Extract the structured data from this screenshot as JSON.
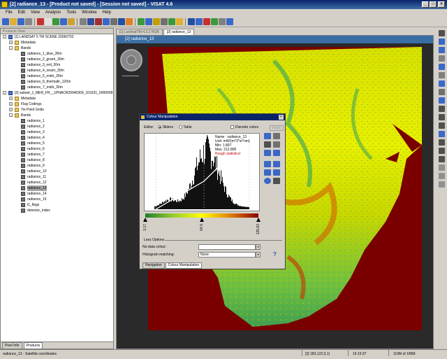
{
  "window": {
    "title": "[2] radiance_13 - [Product not saved] - [Session not saved] - VISAT 4.6",
    "minimize": "_",
    "maximize": "□",
    "close": "×"
  },
  "menu": [
    "File",
    "Edit",
    "View",
    "Analysis",
    "Tools",
    "Window",
    "Help"
  ],
  "toolbar_colors": [
    "#3a68c8",
    "#e0b030",
    "#3a68c8",
    "#888888",
    "#c83030",
    "#e0e0e0",
    "#3a9a3a",
    "#3a68c8",
    "#d0a030",
    "#808080",
    "#3050a0",
    "#a03030",
    "#3a68c8",
    "#707070",
    "#2050a0",
    "#e08020",
    "#3a9a3a",
    "#3a68c8",
    "#c0a000",
    "#707070",
    "#3a9a3a",
    "#e0b030",
    "#2050a0",
    "#3a68c8",
    "#c83030",
    "#3a9a3a",
    "#808080",
    "#3a68c8"
  ],
  "left_panel": {
    "header": "Products View",
    "tree": [
      {
        "indent": 0,
        "exp": "-",
        "icon": "prod",
        "label": "[1] LANDSAT 5 TM SCENE 20060702"
      },
      {
        "indent": 1,
        "exp": "+",
        "icon": "folder",
        "label": "Metadata"
      },
      {
        "indent": 1,
        "exp": "-",
        "icon": "folder",
        "label": "Bands"
      },
      {
        "indent": 2,
        "exp": "",
        "icon": "band",
        "label": "radiance_1_blue_30m"
      },
      {
        "indent": 2,
        "exp": "",
        "icon": "band",
        "label": "radiance_2_green_30m"
      },
      {
        "indent": 2,
        "exp": "",
        "icon": "band",
        "label": "radiance_3_red_30m"
      },
      {
        "indent": 2,
        "exp": "",
        "icon": "band",
        "label": "radiance_4_nearir_30m"
      },
      {
        "indent": 2,
        "exp": "",
        "icon": "band",
        "label": "radiance_5_midir_30m"
      },
      {
        "indent": 2,
        "exp": "",
        "icon": "band",
        "label": "radiance_6_thermalir_120m"
      },
      {
        "indent": 2,
        "exp": "",
        "icon": "band",
        "label": "radiance_7_midir_30m"
      },
      {
        "indent": 0,
        "exp": "-",
        "icon": "prod",
        "label": "[2] subset_1_MER_FR__1PNACR20040309_101631_0000009"
      },
      {
        "indent": 1,
        "exp": "+",
        "icon": "folder",
        "label": "Metadata"
      },
      {
        "indent": 1,
        "exp": "+",
        "icon": "folder",
        "label": "Flag Codings"
      },
      {
        "indent": 1,
        "exp": "+",
        "icon": "folder",
        "label": "Tie Point Grids"
      },
      {
        "indent": 1,
        "exp": "-",
        "icon": "folder",
        "label": "Bands"
      },
      {
        "indent": 2,
        "exp": "",
        "icon": "band",
        "label": "radiance_1"
      },
      {
        "indent": 2,
        "exp": "",
        "icon": "band",
        "label": "radiance_2"
      },
      {
        "indent": 2,
        "exp": "",
        "icon": "band",
        "label": "radiance_3"
      },
      {
        "indent": 2,
        "exp": "",
        "icon": "band",
        "label": "radiance_4"
      },
      {
        "indent": 2,
        "exp": "",
        "icon": "band",
        "label": "radiance_5"
      },
      {
        "indent": 2,
        "exp": "",
        "icon": "band",
        "label": "radiance_6"
      },
      {
        "indent": 2,
        "exp": "",
        "icon": "band",
        "label": "radiance_7"
      },
      {
        "indent": 2,
        "exp": "",
        "icon": "band",
        "label": "radiance_8"
      },
      {
        "indent": 2,
        "exp": "",
        "icon": "band",
        "label": "radiance_9"
      },
      {
        "indent": 2,
        "exp": "",
        "icon": "band",
        "label": "radiance_10"
      },
      {
        "indent": 2,
        "exp": "",
        "icon": "band",
        "label": "radiance_11"
      },
      {
        "indent": 2,
        "exp": "",
        "icon": "band",
        "label": "radiance_12"
      },
      {
        "indent": 2,
        "exp": "",
        "icon": "band",
        "label": "radiance_13",
        "selected": true
      },
      {
        "indent": 2,
        "exp": "",
        "icon": "band",
        "label": "radiance_14"
      },
      {
        "indent": 2,
        "exp": "",
        "icon": "band",
        "label": "radiance_15"
      },
      {
        "indent": 2,
        "exp": "",
        "icon": "band",
        "label": "l1_flags"
      },
      {
        "indent": 2,
        "exp": "",
        "icon": "band",
        "label": "detector_index"
      }
    ],
    "tabs": [
      "Pixel Info",
      "Products"
    ]
  },
  "doc_tabs": [
    "[1] LandsatTM 4,3,2 RGB",
    "[2] radiance_13"
  ],
  "image_view": {
    "title": "[2] radiance_13"
  },
  "right_tool_colors": [
    "#505050",
    "#3a68c8",
    "#3a68c8",
    "#808080",
    "#3a68c8",
    "#808080",
    "#3a68c8",
    "#707070",
    "#3a68c8",
    "#505050",
    "#505050",
    "#505050",
    "#3a68c8",
    "#505050",
    "#505050",
    "#505050",
    "#909090",
    "#909090",
    "#909090"
  ],
  "colour_manipulation": {
    "title": "Colour Manipulation",
    "editor_label": "Editor:",
    "sliders_label": "Sliders",
    "table_label": "Table",
    "discrete_label": "Discrete colors",
    "apply_label": "Apply",
    "stats": {
      "name": "Name : radiance_13",
      "unit": "Unit: mW/(m^2*sr*nm)",
      "min": "Min: 1.897",
      "max": "Max: 212.805",
      "warning": "Rough statistics!"
    },
    "slider_values": [
      "3.17",
      "64.5",
      "125.83"
    ],
    "slider_positions": [
      0.0,
      0.5,
      1.0
    ],
    "less_options": "Less Options",
    "no_data_label": "No-data colour:",
    "histogram_label": "Histogram matching:",
    "histogram_value": "None",
    "help": "?",
    "tabs": [
      "Navigation",
      "Colour Manipulation"
    ]
  },
  "status": {
    "left": "radiance_13 - Satellite coordinates",
    "pixel": "[2] 183,123 (L1)",
    "time": "16:15:37",
    "memory": "119M of 189M"
  }
}
